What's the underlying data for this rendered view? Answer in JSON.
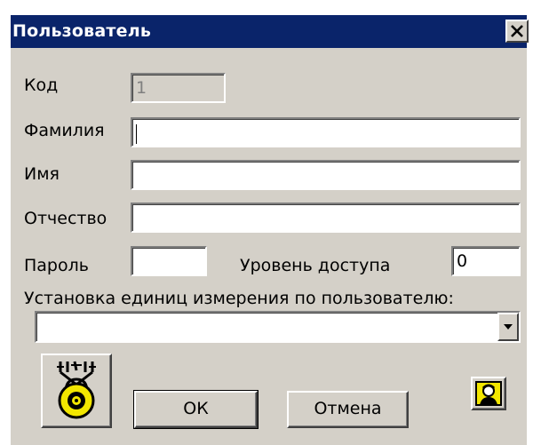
{
  "window": {
    "title": "Пользователь",
    "close_glyph": "✕"
  },
  "form": {
    "code": {
      "label": "Код",
      "value": "1",
      "enabled": false
    },
    "last_name": {
      "label": "Фамилия",
      "value": ""
    },
    "first_name": {
      "label": "Имя",
      "value": ""
    },
    "patronymic": {
      "label": "Отчество",
      "value": ""
    },
    "password": {
      "label": "Пароль",
      "value": ""
    },
    "access_level": {
      "label": "Уровень доступа",
      "value": "0"
    },
    "units": {
      "label": "Установка единиц измерения по пользователю:",
      "value": ""
    }
  },
  "buttons": {
    "ok": "ОК",
    "cancel": "Отмена",
    "lock_icon": "lock-chains-icon",
    "user_icon": "user-portrait-icon"
  },
  "colors": {
    "titlebar": "#0a246a",
    "face": "#d4d0c8",
    "lock_yellow": "#f2e600"
  }
}
